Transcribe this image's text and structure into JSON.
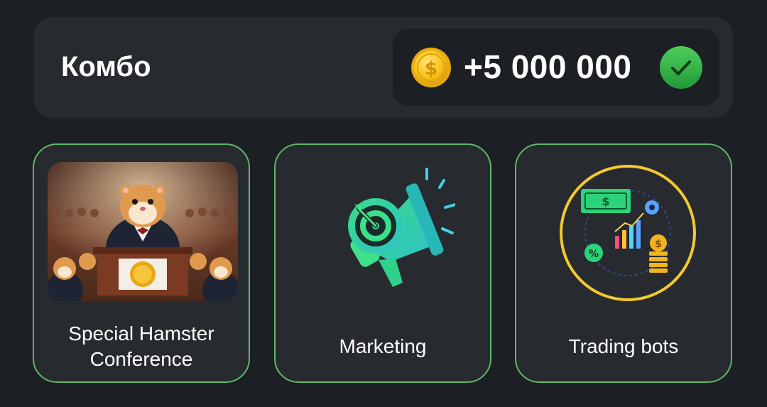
{
  "combo": {
    "title": "Комбо",
    "reward": "+5 000 000",
    "coin_icon": "gold-coin-icon",
    "status_icon": "checkmark-icon",
    "status_color": "#3bb54a"
  },
  "cards": [
    {
      "label": "Special Hamster Conference",
      "image": "hamster-conference-image",
      "border_color": "#5fb86a"
    },
    {
      "label": "Marketing",
      "image": "megaphone-target-icon",
      "border_color": "#5fb86a"
    },
    {
      "label": "Trading bots",
      "image": "trading-bots-icon",
      "border_color": "#5fb86a"
    }
  ]
}
